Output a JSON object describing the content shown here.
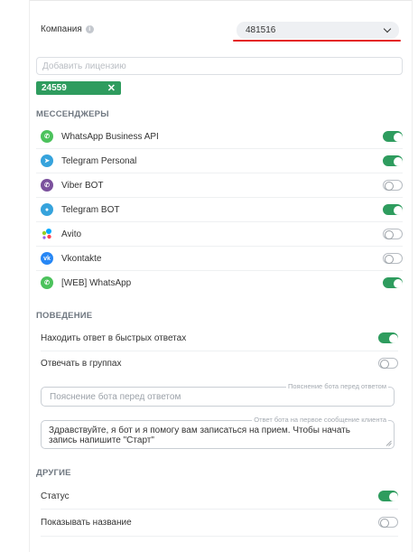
{
  "company": {
    "label": "Компания",
    "value": "481516"
  },
  "license": {
    "placeholder": "Добавить лицензию",
    "tag": "24559"
  },
  "messengers": {
    "title": "МЕССЕНДЖЕРЫ",
    "items": [
      {
        "label": "WhatsApp Business API",
        "icon": "whatsapp-icon",
        "color": "#4cc25c",
        "on": true
      },
      {
        "label": "Telegram Personal",
        "icon": "telegram-icon",
        "color": "#36a3dc",
        "on": true
      },
      {
        "label": "Viber BOT",
        "icon": "viber-icon",
        "color": "#7b519d",
        "on": false
      },
      {
        "label": "Telegram BOT",
        "icon": "telegram-bot-icon",
        "color": "#36a3dc",
        "on": true
      },
      {
        "label": "Avito",
        "icon": "avito-icon",
        "color": "#00aaff",
        "on": false
      },
      {
        "label": "Vkontakte",
        "icon": "vk-icon",
        "color": "#2787f5",
        "on": false
      },
      {
        "label": "[WEB] WhatsApp",
        "icon": "whatsapp-icon",
        "color": "#4cc25c",
        "on": true
      }
    ]
  },
  "behavior": {
    "title": "ПОВЕДЕНИЕ",
    "find_answer": {
      "label": "Находить ответ в быстрых ответах",
      "on": true
    },
    "reply_groups": {
      "label": "Отвечать в группах",
      "on": false
    },
    "explanation": {
      "legend": "Пояснение бота перед ответом",
      "placeholder": "Пояснение бота перед ответом"
    },
    "first_message": {
      "legend": "Ответ бота на первое сообщение клиента",
      "text": "Здравствуйте, я бот и я помогу вам записаться на прием. Чтобы начать запись напишите \"Старт\""
    }
  },
  "other": {
    "title": "ДРУГИЕ",
    "status": {
      "label": "Статус",
      "on": true
    },
    "show_name": {
      "label": "Показывать название",
      "on": false
    }
  },
  "colors": {
    "accent": "#2e9c5e",
    "underline": "#e42121"
  }
}
